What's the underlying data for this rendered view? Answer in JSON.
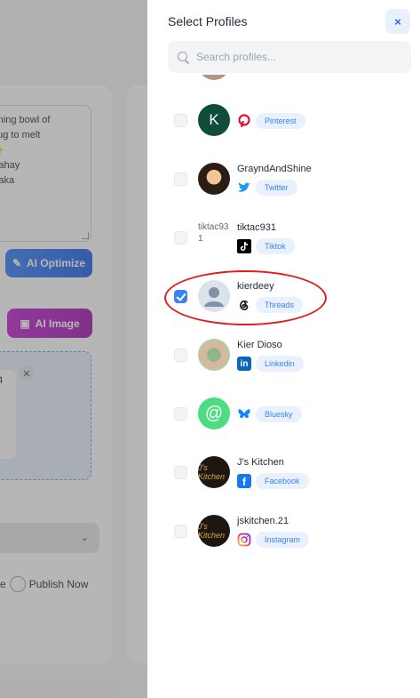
{
  "background": {
    "post_text_lines": [
      "rming bowl of",
      "hug to melt",
      "✨",
      "Bahay",
      "Baka"
    ],
    "ai_optimize_label": "AI Optimize",
    "ai_image_label": "AI Image",
    "media_filename": "p4",
    "publish_prefix": "e",
    "publish_now_label": "Publish Now"
  },
  "panel": {
    "title": "Select Profiles",
    "close_label": "×",
    "search_placeholder": "Search profiles..."
  },
  "profiles": [
    {
      "name": "",
      "platform": "Pinterest",
      "avatar_letter": "K",
      "checked": false
    },
    {
      "name": "GrayndAndShine",
      "platform": "Twitter",
      "checked": false
    },
    {
      "name": "tiktac931",
      "platform": "Tiktok",
      "avatar_alt": "tiktac931",
      "checked": false
    },
    {
      "name": "kierdeey",
      "platform": "Threads",
      "checked": true
    },
    {
      "name": "Kier Dioso",
      "platform": "Linkedin",
      "checked": false
    },
    {
      "name": "",
      "platform": "Bluesky",
      "avatar_letter": "@",
      "checked": false
    },
    {
      "name": "J's Kitchen",
      "platform": "Facebook",
      "checked": false
    },
    {
      "name": "jskitchen.21",
      "platform": "Instagram",
      "checked": false
    }
  ],
  "colors": {
    "accent": "#3b82f6",
    "highlight_ring": "#e11d1d",
    "pinterest": "#e60023",
    "twitter": "#1d9bf0",
    "linkedin": "#0a66c2",
    "bluesky": "#1185fe",
    "facebook": "#1877f2"
  }
}
